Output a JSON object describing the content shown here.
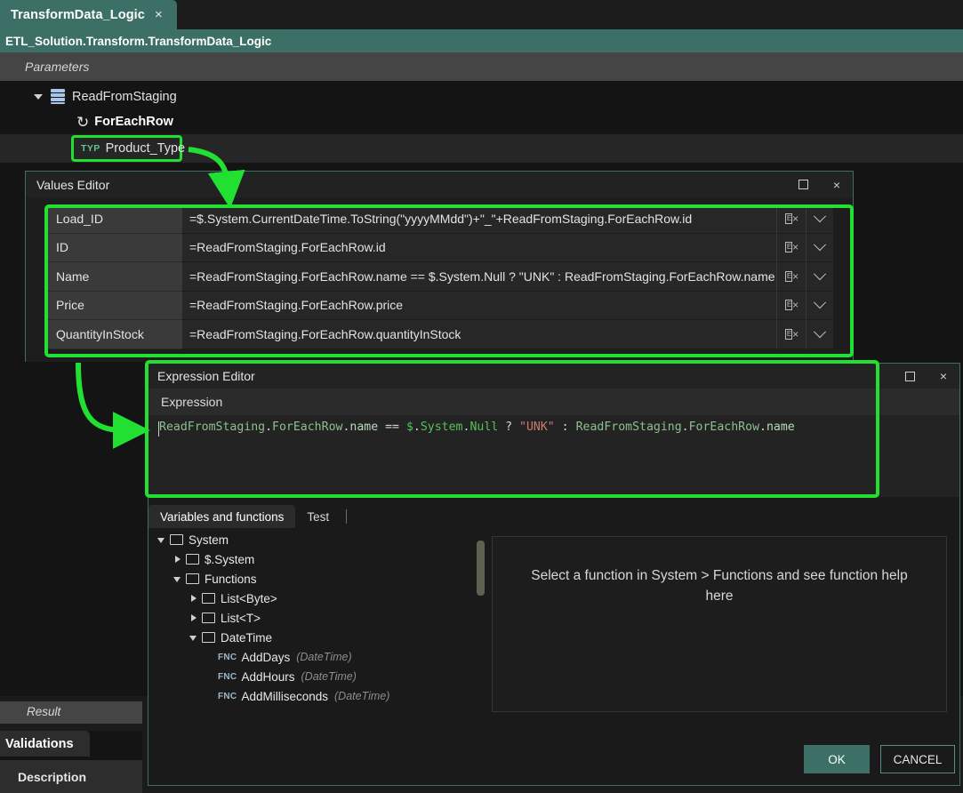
{
  "tab": {
    "label": "TransformData_Logic",
    "close_icon": "×"
  },
  "breadcrumb": {
    "path": "ETL_Solution.Transform.TransformData_Logic"
  },
  "parameters_bar": {
    "label": "Parameters"
  },
  "tree": {
    "nodes": [
      {
        "label": "ReadFromStaging",
        "icon": "database-icon"
      },
      {
        "label": "ForEachRow",
        "icon": "loop-icon",
        "glyph": "↺"
      },
      {
        "tag": "TYP",
        "label": "Product_Type"
      }
    ]
  },
  "values_editor": {
    "title": "Values Editor",
    "maximize_icon": "□",
    "close_icon": "×",
    "ex_label": "E",
    "ex_x": "×",
    "rows": [
      {
        "name": "Load_ID",
        "value": "=$.System.CurrentDateTime.ToString(\"yyyyMMdd\")+\"_\"+ReadFromStaging.ForEachRow.id"
      },
      {
        "name": "ID",
        "value": "=ReadFromStaging.ForEachRow.id"
      },
      {
        "name": "Name",
        "value": "=ReadFromStaging.ForEachRow.name == $.System.Null ? \"UNK\" : ReadFromStaging.ForEachRow.name"
      },
      {
        "name": "Price",
        "value": "=ReadFromStaging.ForEachRow.price"
      },
      {
        "name": "QuantityInStock",
        "value": "=ReadFromStaging.ForEachRow.quantityInStock"
      }
    ]
  },
  "expression_editor": {
    "title": "Expression Editor",
    "maximize_icon": "□",
    "close_icon": "×",
    "section_label": "Expression",
    "expression_parts": [
      {
        "text": "ReadFromStaging",
        "cls": "c-id"
      },
      {
        "text": ".",
        "cls": "c-op"
      },
      {
        "text": "ForEachRow",
        "cls": "c-id"
      },
      {
        "text": ".",
        "cls": "c-op"
      },
      {
        "text": "name",
        "cls": "c-mem"
      },
      {
        "text": " == ",
        "cls": "c-op"
      },
      {
        "text": "$",
        "cls": "c-sys"
      },
      {
        "text": ".",
        "cls": "c-op"
      },
      {
        "text": "System",
        "cls": "c-sys"
      },
      {
        "text": ".",
        "cls": "c-op"
      },
      {
        "text": "Null",
        "cls": "c-sys"
      },
      {
        "text": " ? ",
        "cls": "c-op"
      },
      {
        "text": "\"UNK\"",
        "cls": "c-str"
      },
      {
        "text": " : ",
        "cls": "c-op"
      },
      {
        "text": "ReadFromStaging",
        "cls": "c-id"
      },
      {
        "text": ".",
        "cls": "c-op"
      },
      {
        "text": "ForEachRow",
        "cls": "c-id"
      },
      {
        "text": ".",
        "cls": "c-op"
      },
      {
        "text": "name",
        "cls": "c-mem"
      }
    ],
    "expression_text": "ReadFromStaging.ForEachRow.name == $.System.Null ? \"UNK\" : ReadFromStaging.ForEachRow.name",
    "tabs": [
      {
        "label": "Variables and functions",
        "active": true
      },
      {
        "label": "Test",
        "active": false
      }
    ],
    "tree": [
      {
        "indent": 0,
        "twisty": "down",
        "kind": "folder",
        "label": "System"
      },
      {
        "indent": 1,
        "twisty": "right",
        "kind": "folder",
        "label": "$.System"
      },
      {
        "indent": 1,
        "twisty": "down",
        "kind": "folder",
        "label": "Functions"
      },
      {
        "indent": 2,
        "twisty": "right",
        "kind": "folder",
        "label": "List<Byte>"
      },
      {
        "indent": 2,
        "twisty": "right",
        "kind": "folder",
        "label": "List<T>"
      },
      {
        "indent": 2,
        "twisty": "down",
        "kind": "folder",
        "label": "DateTime"
      },
      {
        "indent": 3,
        "twisty": "none",
        "kind": "fnc",
        "tag": "FNC",
        "label": "AddDays",
        "type": "(DateTime)"
      },
      {
        "indent": 3,
        "twisty": "none",
        "kind": "fnc",
        "tag": "FNC",
        "label": "AddHours",
        "type": "(DateTime)"
      },
      {
        "indent": 3,
        "twisty": "none",
        "kind": "fnc",
        "tag": "FNC",
        "label": "AddMilliseconds",
        "type": "(DateTime)"
      }
    ],
    "help_text": "Select a function in System > Functions and see function help here",
    "ok_label": "OK",
    "cancel_label": "CANCEL"
  },
  "bottom": {
    "result_label": "Result",
    "validations_tab": "Validations",
    "description_label": "Description"
  },
  "colors": {
    "accent_teal": "#3c6f65",
    "annotation_green": "#22e032",
    "panel_dark": "#1a1a1a",
    "row_alt": "#3a3a3a"
  }
}
